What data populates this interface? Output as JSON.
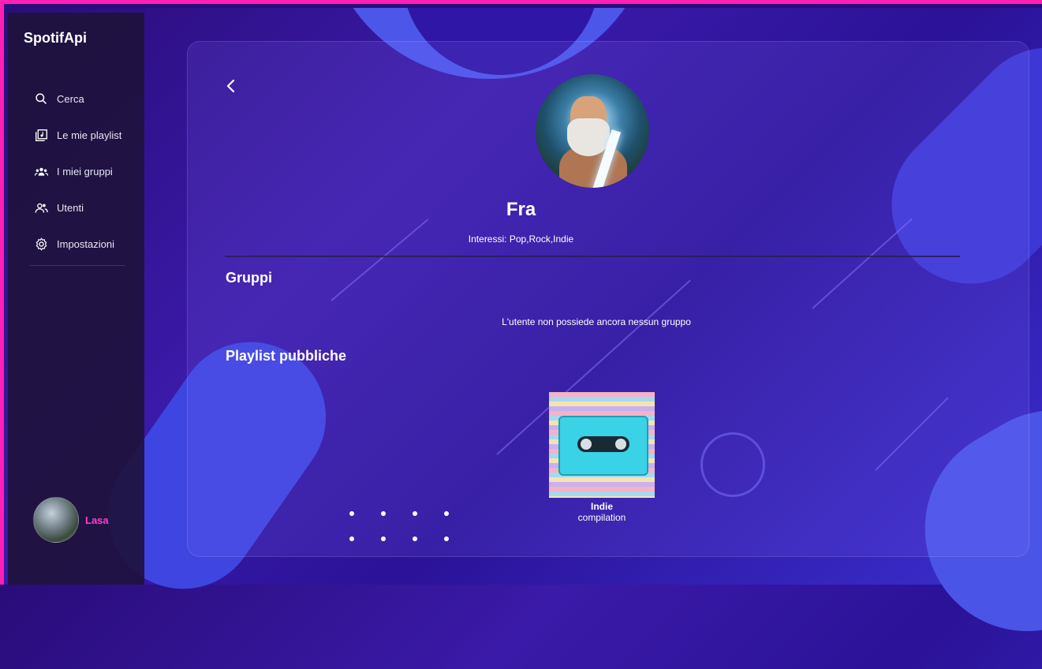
{
  "app": {
    "title": "SpotifApi"
  },
  "sidebar": {
    "items": [
      {
        "label": "Cerca",
        "icon": "search-icon"
      },
      {
        "label": "Le mie playlist",
        "icon": "playlist-icon"
      },
      {
        "label": "I miei gruppi",
        "icon": "groups-icon"
      },
      {
        "label": "Utenti",
        "icon": "users-icon"
      },
      {
        "label": "Impostazioni",
        "icon": "settings-icon"
      }
    ],
    "user": {
      "name": "Lasa"
    }
  },
  "profile": {
    "name": "Fra",
    "interests": "Interessi: Pop,Rock,Indie"
  },
  "groups": {
    "heading": "Gruppi",
    "empty_message": "L'utente non possiede ancora nessun gruppo"
  },
  "playlists": {
    "heading": "Playlist pubbliche",
    "items": [
      {
        "title": "Indie",
        "subtitle": "compilation"
      }
    ]
  },
  "colors": {
    "accent": "#ff1fb4",
    "user_name": "#ff3fc9"
  }
}
